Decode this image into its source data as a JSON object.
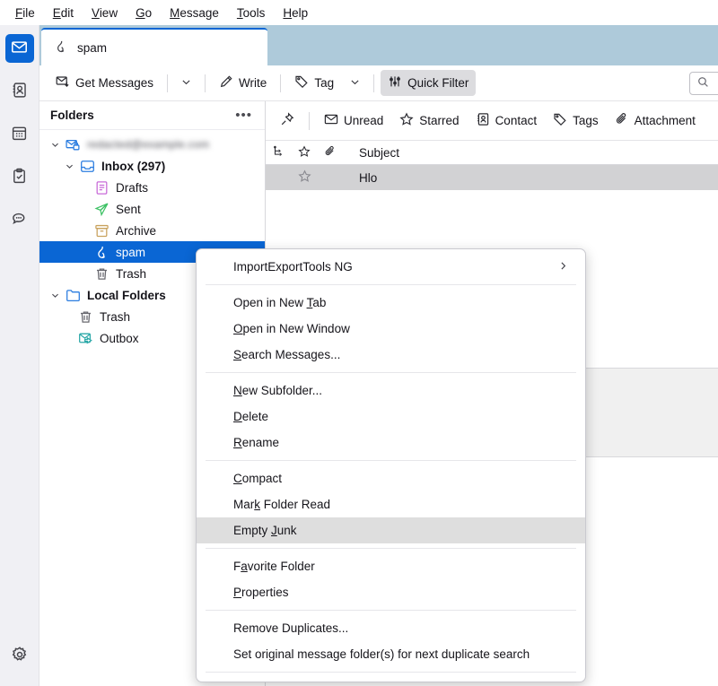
{
  "menubar": {
    "items": [
      {
        "label": "File",
        "accel": "F"
      },
      {
        "label": "Edit",
        "accel": "E"
      },
      {
        "label": "View",
        "accel": "V"
      },
      {
        "label": "Go",
        "accel": "G"
      },
      {
        "label": "Message",
        "accel": "M"
      },
      {
        "label": "Tools",
        "accel": "T"
      },
      {
        "label": "Help",
        "accel": "H"
      }
    ]
  },
  "rail": {
    "items": [
      {
        "name": "mail-icon",
        "active": true
      },
      {
        "name": "address-book-icon",
        "active": false
      },
      {
        "name": "calendar-icon",
        "active": false
      },
      {
        "name": "tasks-icon",
        "active": false
      },
      {
        "name": "chat-icon",
        "active": false
      }
    ],
    "settings": {
      "name": "gear-icon"
    }
  },
  "tabs": {
    "active": {
      "label": "spam",
      "icon": "flame-icon"
    }
  },
  "toolbar": {
    "get_messages_label": "Get Messages",
    "write_label": "Write",
    "tag_label": "Tag",
    "quick_filter_label": "Quick Filter",
    "search_placeholder": ""
  },
  "quick_filter": {
    "pin_icon": "pin-icon",
    "buttons": [
      {
        "label": "Unread",
        "icon": "unread-icon"
      },
      {
        "label": "Starred",
        "icon": "star-icon"
      },
      {
        "label": "Contact",
        "icon": "contact-icon"
      },
      {
        "label": "Tags",
        "icon": "tag-icon"
      },
      {
        "label": "Attachment",
        "icon": "paperclip-icon"
      }
    ]
  },
  "folders": {
    "title": "Folders",
    "more_label": "•••",
    "tree": [
      {
        "label": "redacted@example.com",
        "type": "account",
        "icon": "account-mail-lock-icon",
        "depth": 0,
        "expanded": true,
        "bold": false,
        "blurred": true,
        "selected": false
      },
      {
        "label": "Inbox (297)",
        "type": "inbox",
        "icon": "inbox-icon",
        "depth": 1,
        "expanded": true,
        "bold": true,
        "blurred": false,
        "selected": false
      },
      {
        "label": "Drafts",
        "type": "drafts",
        "icon": "drafts-icon",
        "depth": 2,
        "expanded": null,
        "bold": false,
        "blurred": false,
        "selected": false
      },
      {
        "label": "Sent",
        "type": "sent",
        "icon": "sent-icon",
        "depth": 2,
        "expanded": null,
        "bold": false,
        "blurred": false,
        "selected": false
      },
      {
        "label": "Archive",
        "type": "archive",
        "icon": "archive-icon",
        "depth": 2,
        "expanded": null,
        "bold": false,
        "blurred": false,
        "selected": false
      },
      {
        "label": "spam",
        "type": "junk",
        "icon": "flame-icon",
        "depth": 2,
        "expanded": null,
        "bold": false,
        "blurred": false,
        "selected": true
      },
      {
        "label": "Trash",
        "type": "trash",
        "icon": "trash-icon",
        "depth": 2,
        "expanded": null,
        "bold": false,
        "blurred": false,
        "selected": false
      },
      {
        "label": "Local Folders",
        "type": "local",
        "icon": "folder-icon",
        "depth": 0,
        "expanded": true,
        "bold": true,
        "blurred": false,
        "selected": false
      },
      {
        "label": "Trash",
        "type": "trash",
        "icon": "trash-icon",
        "depth": 1,
        "expanded": null,
        "bold": false,
        "blurred": false,
        "selected": false
      },
      {
        "label": "Outbox",
        "type": "outbox",
        "icon": "outbox-icon",
        "depth": 1,
        "expanded": null,
        "bold": false,
        "blurred": false,
        "selected": false
      }
    ]
  },
  "message_list": {
    "columns": [
      {
        "label": "",
        "icon": "thread-icon"
      },
      {
        "label": "",
        "icon": "star-icon"
      },
      {
        "label": "",
        "icon": "paperclip-icon"
      },
      {
        "label": "Subject",
        "icon": null
      }
    ],
    "rows": [
      {
        "subject": "Hlo",
        "starred": false,
        "selected": true
      }
    ]
  },
  "context_menu": {
    "items": [
      {
        "label": "ImportExportTools NG",
        "accel": null,
        "submenu": true,
        "highlight": false,
        "separator_after": true
      },
      {
        "label": "Open in New Tab",
        "accel": "T",
        "submenu": false,
        "highlight": false,
        "separator_after": false
      },
      {
        "label": "Open in New Window",
        "accel": "O",
        "submenu": false,
        "highlight": false,
        "separator_after": false
      },
      {
        "label": "Search Messages...",
        "accel": "S",
        "submenu": false,
        "highlight": false,
        "separator_after": true
      },
      {
        "label": "New Subfolder...",
        "accel": "N",
        "submenu": false,
        "highlight": false,
        "separator_after": false
      },
      {
        "label": "Delete",
        "accel": "D",
        "submenu": false,
        "highlight": false,
        "separator_after": false
      },
      {
        "label": "Rename",
        "accel": "R",
        "submenu": false,
        "highlight": false,
        "separator_after": true
      },
      {
        "label": "Compact",
        "accel": "C",
        "submenu": false,
        "highlight": false,
        "separator_after": false
      },
      {
        "label": "Mark Folder Read",
        "accel": "k",
        "submenu": false,
        "highlight": false,
        "separator_after": false
      },
      {
        "label": "Empty Junk",
        "accel": "J",
        "submenu": false,
        "highlight": true,
        "separator_after": true
      },
      {
        "label": "Favorite Folder",
        "accel": "a",
        "submenu": false,
        "highlight": false,
        "separator_after": false
      },
      {
        "label": "Properties",
        "accel": "P",
        "submenu": false,
        "highlight": false,
        "separator_after": true
      },
      {
        "label": "Remove Duplicates...",
        "accel": null,
        "submenu": false,
        "highlight": false,
        "separator_after": false
      },
      {
        "label": "Set original message folder(s) for next duplicate search",
        "accel": null,
        "submenu": false,
        "highlight": false,
        "separator_after": true
      }
    ],
    "submenu_arrow": "›"
  },
  "colors": {
    "accent": "#0a66d4",
    "tabstrip_bg": "#aecada",
    "selection_bg": "#0a66d4",
    "menu_highlight": "#dedede",
    "row_selected": "#d2d2d4"
  }
}
